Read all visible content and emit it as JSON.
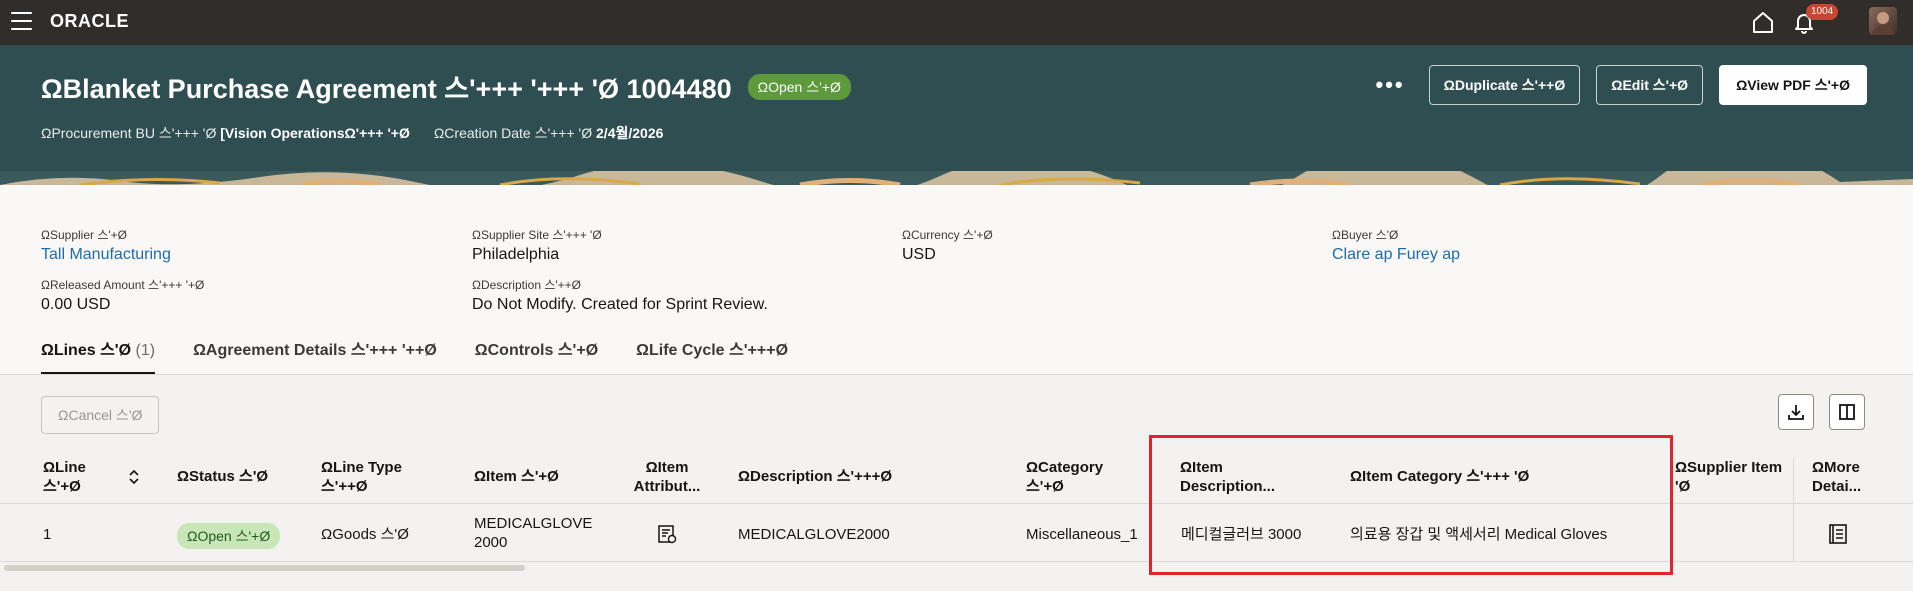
{
  "topbar": {
    "logo": "ORACLE",
    "notification_count": "1004"
  },
  "header": {
    "title": "ΩBlanket Purchase Agreement 스'+++ '+++ 'Ø 1004480",
    "status": "ΩOpen 스'+Ø",
    "procurement_bu_label": "ΩProcurement BU 스'+++ 'Ø",
    "procurement_bu_value": "[Vision OperationsΩ'+++ '+Ø",
    "creation_date_label": "ΩCreation Date 스'+++ 'Ø",
    "creation_date_value": "2/4월/2026",
    "more_label": "•••",
    "duplicate_label": "ΩDuplicate 스'++Ø",
    "edit_label": "ΩEdit 스'+Ø",
    "view_pdf_label": "ΩView PDF 스'+Ø"
  },
  "info": {
    "supplier_label": "ΩSupplier 스'+Ø",
    "supplier_value": "Tall Manufacturing",
    "supplier_site_label": "ΩSupplier Site 스'+++ 'Ø",
    "supplier_site_value": "Philadelphia",
    "currency_label": "ΩCurrency 스'+Ø",
    "currency_value": "USD",
    "buyer_label": "ΩBuyer 스'Ø",
    "buyer_value": "Clare ap Furey ap",
    "released_amount_label": "ΩReleased Amount 스'+++ '+Ø",
    "released_amount_value": "0.00 USD",
    "description_label": "ΩDescription 스'++Ø",
    "description_value": "Do Not Modify. Created for Sprint Review."
  },
  "tabs": [
    {
      "label": "ΩLines 스'Ø",
      "count": "(1)"
    },
    {
      "label": "ΩAgreement Details 스'+++ '++Ø"
    },
    {
      "label": "ΩControls 스'+Ø"
    },
    {
      "label": "ΩLife Cycle 스'+++Ø"
    }
  ],
  "lines": {
    "cancel_label": "ΩCancel 스'Ø",
    "columns": {
      "line_1": "ΩLine",
      "line_2": "스'+Ø",
      "status": "ΩStatus 스'Ø",
      "line_type_1": "ΩLine Type",
      "line_type_2": "스'++Ø",
      "item": "ΩItem 스'+Ø",
      "item_attr_1": "ΩItem",
      "item_attr_2": "Attribut...",
      "description": "ΩDescription 스'+++Ø",
      "category_1": "ΩCategory",
      "category_2": "스'+Ø",
      "item_desc_1": "ΩItem",
      "item_desc_2": "Description...",
      "item_category": "ΩItem Category 스'+++ 'Ø",
      "supplier_item_1": "ΩSupplier Item",
      "supplier_item_2": "'Ø",
      "more_details_1": "ΩMore",
      "more_details_2": "Detai..."
    },
    "rows": [
      {
        "line": "1",
        "status": "ΩOpen 스'+Ø",
        "line_type": "ΩGoods 스'Ø",
        "item_1": "MEDICALGLOVE",
        "item_2": "2000",
        "description": "MEDICALGLOVE2000",
        "category": "Miscellaneous_1",
        "item_description": "메디컬글러브 3000",
        "item_category": "의료용 장갑 및 액세서리 Medical Gloves"
      }
    ]
  },
  "colors": {
    "topbar": "#312d2a",
    "header": "#2f4e52",
    "status_green": "#5d9a3b",
    "link": "#1f6bb0",
    "highlight": "#e0242b"
  }
}
